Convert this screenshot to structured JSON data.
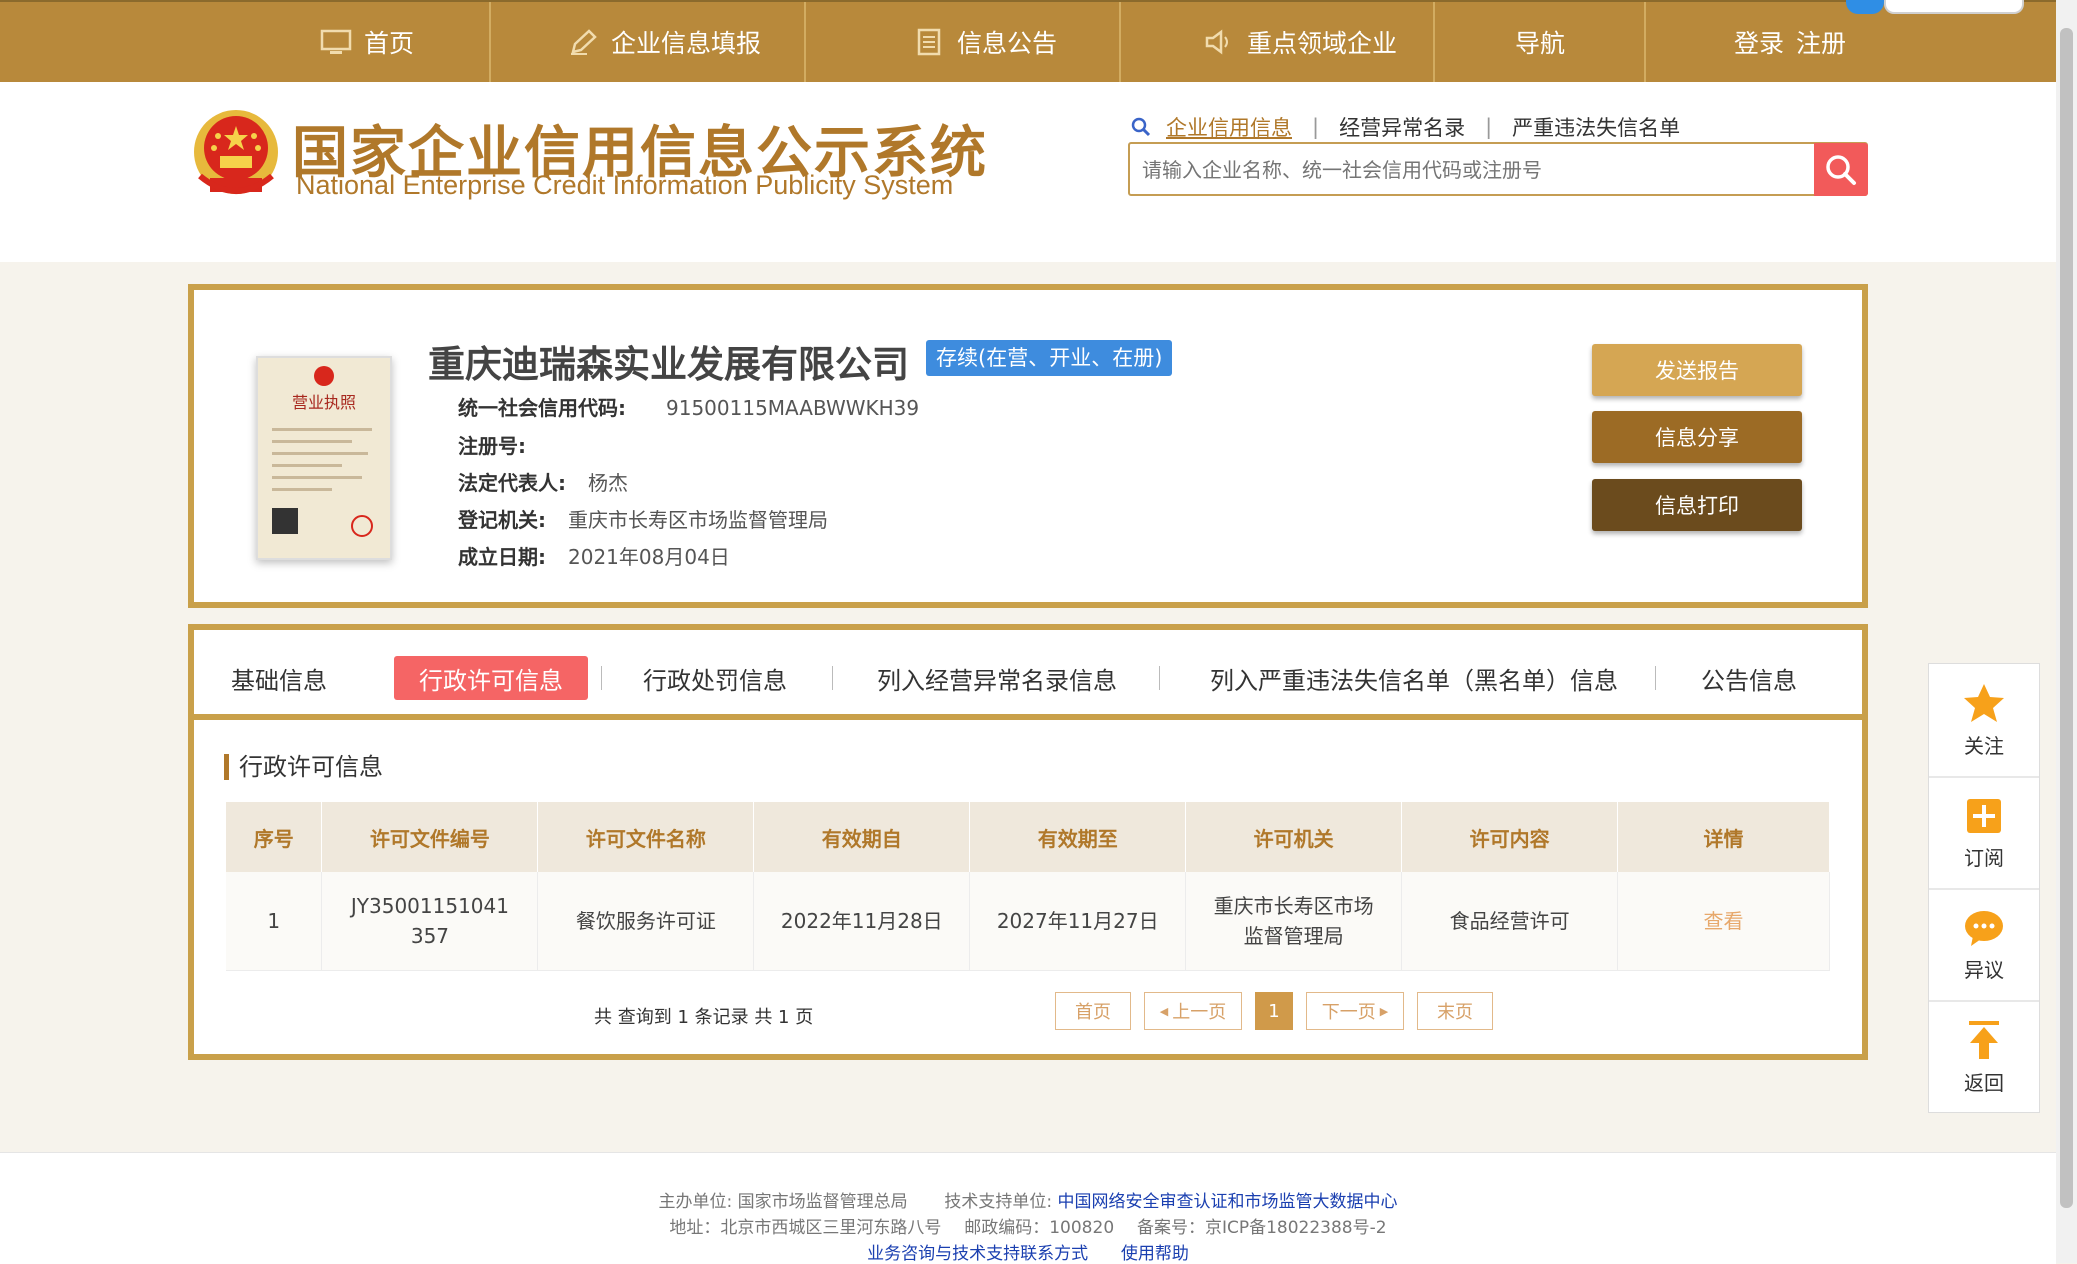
{
  "nav": {
    "items": [
      {
        "label": "首页",
        "icon": "monitor-icon"
      },
      {
        "label": "企业信息填报",
        "icon": "pen-icon"
      },
      {
        "label": "信息公告",
        "icon": "document-icon"
      },
      {
        "label": "重点领域企业",
        "icon": "speaker-icon"
      },
      {
        "label": "导航"
      }
    ],
    "login": "登录",
    "register": "注册"
  },
  "header": {
    "title_cn": "国家企业信用信息公示系统",
    "title_en": "National Enterprise Credit Information Publicity System"
  },
  "search": {
    "tabs": [
      "企业信用信息",
      "经营异常名录",
      "严重违法失信名单"
    ],
    "active_tab": "企业信用信息",
    "placeholder": "请输入企业名称、统一社会信用代码或注册号",
    "value": ""
  },
  "company": {
    "name": "重庆迪瑞森实业发展有限公司",
    "status": "存续(在营、开业、在册)",
    "fields": [
      {
        "label": "统一社会信用代码:",
        "value": "91500115MAABWWKH39"
      },
      {
        "label": "注册号:",
        "value": ""
      },
      {
        "label": "法定代表人:",
        "value": "杨杰"
      },
      {
        "label": "登记机关:",
        "value": "重庆市长寿区市场监督管理局"
      },
      {
        "label": "成立日期:",
        "value": "2021年08月04日"
      }
    ],
    "license_title": "营业执照",
    "buttons": {
      "send": "发送报告",
      "share": "信息分享",
      "print": "信息打印"
    }
  },
  "tabs": {
    "items": [
      "基础信息",
      "行政许可信息",
      "行政处罚信息",
      "列入经营异常名录信息",
      "列入严重违法失信名单（黑名单）信息",
      "公告信息"
    ],
    "active": "行政许可信息"
  },
  "section_title": "行政许可信息",
  "table": {
    "headers": [
      "序号",
      "许可文件编号",
      "许可文件名称",
      "有效期自",
      "有效期至",
      "许可机关",
      "许可内容",
      "详情"
    ],
    "rows": [
      [
        "1",
        "JY35001151041357",
        "餐饮服务许可证",
        "2022年11月28日",
        "2027年11月27日",
        "重庆市长寿区市场监督管理局",
        "食品经营许可",
        "查看"
      ]
    ]
  },
  "pager": {
    "summary": "共 查询到 1 条记录 共 1 页",
    "first": "首页",
    "prev": "上一页",
    "current": "1",
    "next": "下一页",
    "last": "末页"
  },
  "float_panel": {
    "follow": "关注",
    "subscribe": "订阅",
    "objection": "异议",
    "back": "返回"
  },
  "footer": {
    "sponsor_label": "主办单位:",
    "sponsor": "国家市场监督管理总局",
    "tech_label": "技术支持单位:",
    "tech": "中国网络安全审查认证和市场监管大数据中心",
    "address": "地址：北京市西城区三里河东路八号",
    "postcode": "邮政编码：100820",
    "icp": "备案号：京ICP备18022388号-2",
    "link1": "业务咨询与技术支持联系方式",
    "link2": "使用帮助"
  },
  "colors": {
    "brand_gold": "#b8893b",
    "frame_gold": "#c9a04a",
    "active_tab_red": "#f56565",
    "status_blue": "#3e8cde",
    "search_red": "#f25a5a"
  }
}
